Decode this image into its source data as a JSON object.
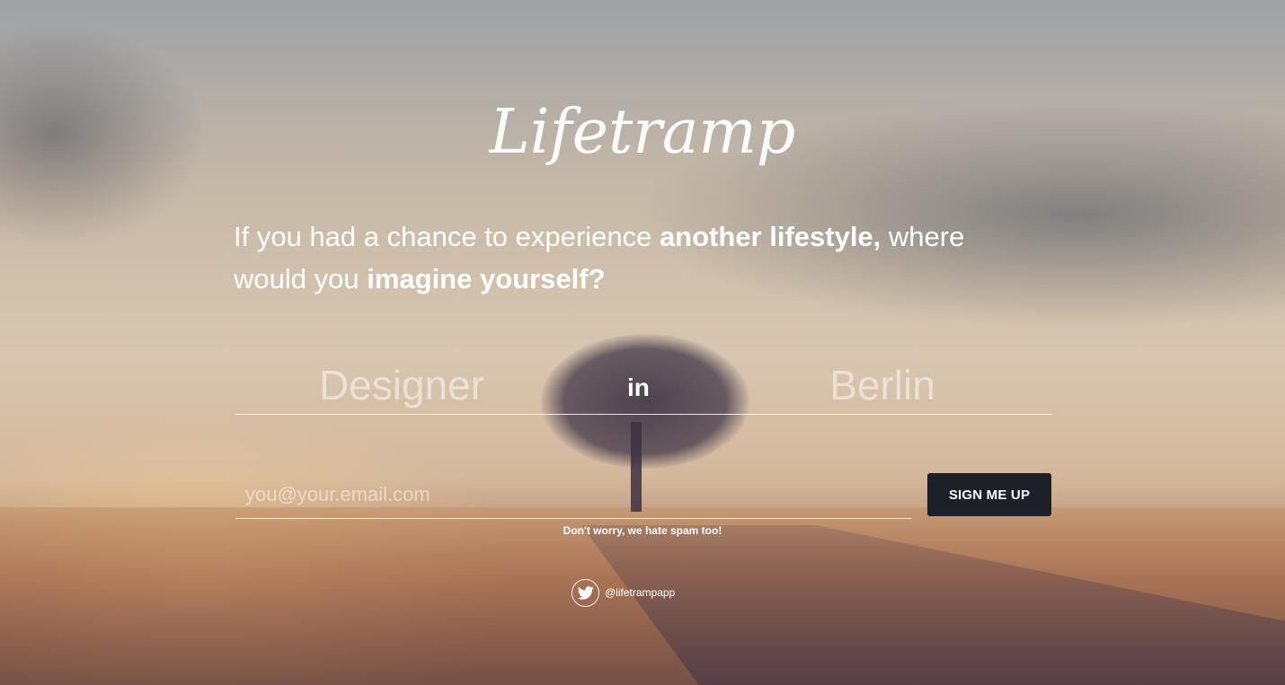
{
  "brand": {
    "logo_text": "Lifetramp"
  },
  "headline": {
    "part1": "If you had a chance to experience ",
    "bold1": "another lifestyle,",
    "part2": " where would you ",
    "bold2": "imagine yourself?"
  },
  "form": {
    "role_placeholder": "Designer",
    "connector": "in",
    "city_placeholder": "Berlin",
    "email_placeholder": "you@your.email.com",
    "submit_label": "SIGN ME UP",
    "spam_note": "Don't worry, we hate spam too!"
  },
  "social": {
    "icon": "twitter-icon",
    "handle": "@lifetrampapp"
  },
  "colors": {
    "button_bg": "#1c2029",
    "text": "#ffffff"
  }
}
